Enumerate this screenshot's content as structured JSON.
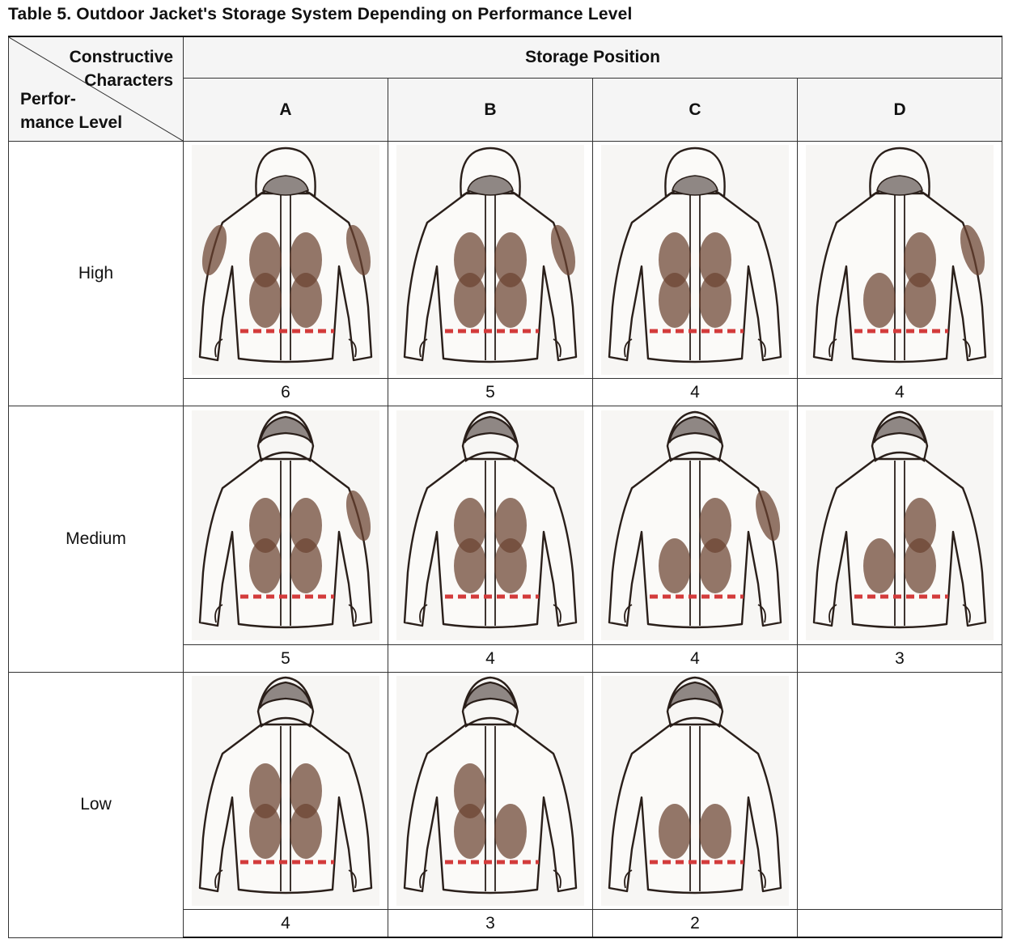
{
  "caption": "Table 5. Outdoor Jacket's Storage System Depending on Performance Level",
  "header": {
    "diag_top_line1": "Constructive",
    "diag_top_line2": "Characters",
    "diag_bottom_line1": "Perfor-",
    "diag_bottom_line2": "mance  Level",
    "group": "Storage  Position",
    "cols": [
      "A",
      "B",
      "C",
      "D"
    ]
  },
  "rows": [
    {
      "level": "High",
      "values": [
        "6",
        "5",
        "4",
        "4"
      ]
    },
    {
      "level": "Medium",
      "values": [
        "5",
        "4",
        "4",
        "3"
      ]
    },
    {
      "level": "Low",
      "values": [
        "4",
        "3",
        "2",
        ""
      ]
    }
  ],
  "colors": {
    "storage_mark": "#6b4330",
    "waist_pocket": "#d33b3b",
    "hood_lining": "#8f8784",
    "jacket_fill": "#fbfaf8"
  }
}
